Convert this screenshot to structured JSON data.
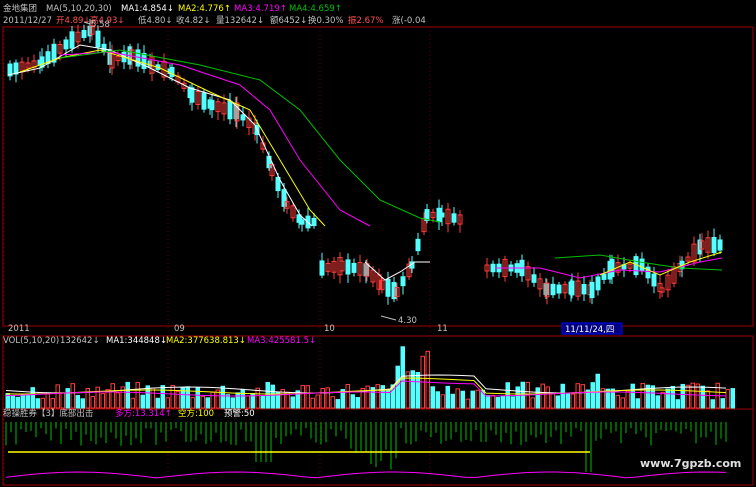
{
  "header": {
    "stock": "金地集团",
    "ma_label": "MA(5,10,20,30)",
    "ma1": "MA1:4.854↓",
    "ma2": "MA2:4.776↑",
    "ma3": "MA3:4.719↑",
    "ma4": "MA4:4.659↑"
  },
  "info": {
    "date": "2011/12/27",
    "open": "开4.89↓",
    "high": "高4.93↓",
    "low": "低4.80↓",
    "close": "收4.82↓",
    "volume": "量132642↓",
    "amount": "额6452↓",
    "turnover": "换0.30%",
    "amplitude": "振2.67%",
    "change": "涨(-0.04"
  },
  "volume_header": {
    "label": "VOL(5,10,20)",
    "vol": "132642↓",
    "ma1": "MA1:344848↓",
    "ma2": "MA2:377638.813↓",
    "ma3": "MA3:425581.5↓"
  },
  "indicator_header": {
    "name": "稳操胜券【3】底部出击",
    "bull": "多方:13.314↑",
    "bear": "空方:100",
    "alert": "预警:50"
  },
  "annotations": {
    "high_price": "5.58",
    "low_price": "4.30",
    "cursor_date": "11/11/24,四"
  },
  "xaxis": {
    "labels": [
      "2011",
      "09",
      "10",
      "11"
    ]
  },
  "watermark": "www.7gpzb.com",
  "colors": {
    "background": "#000000",
    "up": "#ff3c3c",
    "down": "#54ffff",
    "ma1": "#ffffff",
    "ma2": "#ffff00",
    "ma3": "#ff00ff",
    "ma4": "#00c000",
    "header": "#c0c0c0",
    "grid": "#a00000"
  },
  "chart_data": [
    {
      "type": "candlestick",
      "title": "金地集团",
      "indicator": "MA(5,10,20,30)",
      "x_labels": [
        "2011",
        "09",
        "10",
        "11"
      ],
      "annotated_high": 5.58,
      "annotated_low": 4.3,
      "series": [
        {
          "name": "MA1",
          "value": 4.854
        },
        {
          "name": "MA2",
          "value": 4.776
        },
        {
          "name": "MA3",
          "value": 4.719
        },
        {
          "name": "MA4",
          "value": 4.659
        }
      ],
      "last_bar": {
        "date": "2011/12/27",
        "open": 4.89,
        "high": 4.93,
        "low": 4.8,
        "close": 4.82
      }
    },
    {
      "type": "bar",
      "title": "VOL(5,10,20)",
      "last_volume": 132642,
      "series": [
        {
          "name": "MA1",
          "value": 344848
        },
        {
          "name": "MA2",
          "value": 377638.813
        },
        {
          "name": "MA3",
          "value": 425581.5
        }
      ]
    },
    {
      "type": "line",
      "title": "稳操胜券【3】底部出击",
      "series": [
        {
          "name": "多方",
          "value": 13.314
        },
        {
          "name": "空方",
          "value": 100
        },
        {
          "name": "预警",
          "value": 50
        }
      ]
    }
  ]
}
